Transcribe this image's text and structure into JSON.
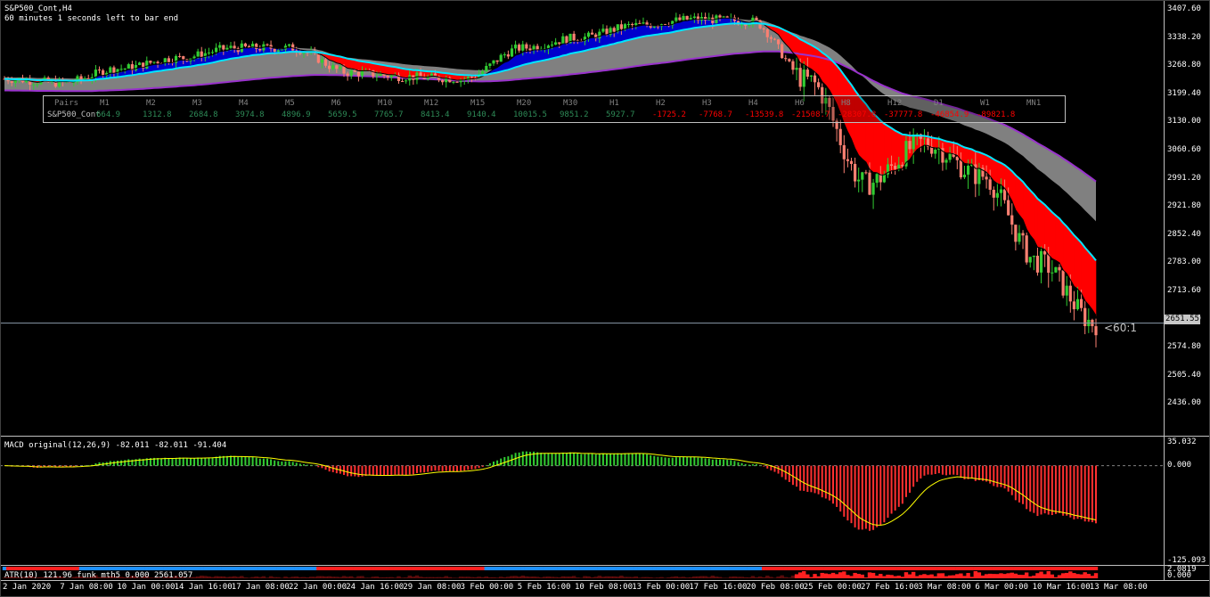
{
  "header": {
    "symbol": "S&P500_Cont,H4",
    "countdown": "60 minutes 1 seconds left to bar end"
  },
  "price_axis": {
    "ticks": [
      "3407.60",
      "3338.20",
      "3268.80",
      "3199.40",
      "3130.00",
      "3060.60",
      "2991.20",
      "2921.80",
      "2852.40",
      "2783.00",
      "2713.60",
      "2644.20",
      "2574.80",
      "2505.40",
      "2436.00"
    ],
    "current_price": "2651.55"
  },
  "ratio_label": "<60:1",
  "pairs_table": {
    "header_label": "Pairs",
    "periods": [
      "M1",
      "M2",
      "M3",
      "M4",
      "M5",
      "M6",
      "M10",
      "M12",
      "M15",
      "M20",
      "M30",
      "H1",
      "H2",
      "H3",
      "H4",
      "H6",
      "H8",
      "H12",
      "D1",
      "W1",
      "MN1"
    ],
    "row_label": "S&P500_Cont",
    "values": [
      "664.9",
      "1312.8",
      "2684.8",
      "3974.8",
      "4896.9",
      "5659.5",
      "7765.7",
      "8413.4",
      "9140.4",
      "10015.5",
      "9851.2",
      "5927.7",
      "-1725.2",
      "-7768.7",
      "-13539.8",
      "-21508.7",
      "-28307.8",
      "-37777.8",
      "-46854.9",
      "-89821.8",
      ""
    ],
    "positive_color": "#2e8b57",
    "negative_color": "#ff0000"
  },
  "macd_panel": {
    "title": "MACD original(12,26,9) -82.011 -82.011 -91.404",
    "ticks": [
      "35.032",
      "0.000",
      "-125.093"
    ]
  },
  "atr_panel": {
    "title": "ATR(10) 121.96  funk mth5 0.000 2561.057",
    "ticks": [
      "2.0819",
      "0.000"
    ]
  },
  "time_axis": [
    "2 Jan 2020",
    "7 Jan 08:00",
    "10 Jan 00:00",
    "14 Jan 16:00",
    "17 Jan 08:00",
    "22 Jan 00:00",
    "24 Jan 16:00",
    "29 Jan 08:00",
    "3 Feb 00:00",
    "5 Feb 16:00",
    "10 Feb 08:00",
    "13 Feb 00:00",
    "17 Feb 16:00",
    "20 Feb 08:00",
    "25 Feb 00:00",
    "27 Feb 16:00",
    "3 Mar 08:00",
    "6 Mar 00:00",
    "10 Mar 16:00",
    "13 Mar 08:00"
  ],
  "colors": {
    "bull_candle": "#32cd32",
    "bear_candle": "#fa8072",
    "fast_ma_up": "#0000cd",
    "fast_ma_down": "#ff0000",
    "slow_cloud": "#808080",
    "ema_line": "#00e5ff",
    "ribbon_lower": "#9932cc",
    "macd_pos": "#32cd32",
    "macd_neg": "#ff3030",
    "signal": "#ffff00"
  },
  "chart_data": {
    "type": "line",
    "title": "S&P500_Cont,H4",
    "x": [
      "2 Jan 2020",
      "7 Jan 08:00",
      "10 Jan 00:00",
      "14 Jan 16:00",
      "17 Jan 08:00",
      "22 Jan 00:00",
      "24 Jan 16:00",
      "29 Jan 08:00",
      "3 Feb 00:00",
      "5 Feb 16:00",
      "10 Feb 08:00",
      "13 Feb 00:00",
      "17 Feb 16:00",
      "20 Feb 08:00",
      "25 Feb 00:00",
      "27 Feb 16:00",
      "3 Mar 08:00",
      "6 Mar 00:00",
      "10 Mar 16:00",
      "13 Mar 08:00"
    ],
    "series": [
      {
        "values": [
          3245,
          3235,
          3270,
          3295,
          3320,
          3320,
          3260,
          3250,
          3245,
          3320,
          3345,
          3375,
          3390,
          3385,
          3240,
          2990,
          3090,
          3010,
          2800,
          2650
        ]
      }
    ],
    "ylim": [
      2380,
      3430
    ],
    "xlabel": "",
    "ylabel": ""
  }
}
